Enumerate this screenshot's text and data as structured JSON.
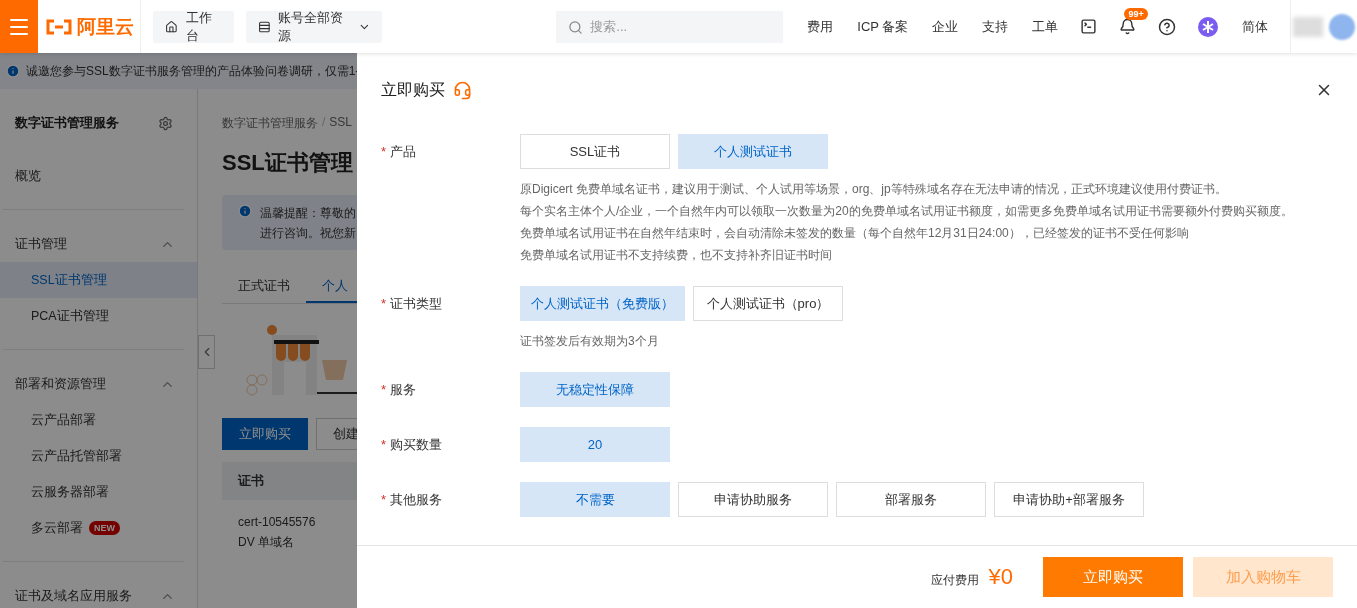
{
  "header": {
    "logo": "阿里云",
    "workbench": "工作台",
    "resources": "账号全部资源",
    "search": {
      "placeholder": "搜索..."
    },
    "nav": [
      "费用",
      "ICP 备案",
      "企业",
      "支持",
      "工单"
    ],
    "notification_badge": "99+",
    "language": "简体"
  },
  "banner": {
    "text": "诚邀您参与SSL数字证书服务管理的产品体验问卷调研，仅需1-"
  },
  "sidebar": {
    "title": "数字证书管理服务",
    "items": [
      {
        "label": "概览",
        "selected": false
      }
    ],
    "groups": [
      {
        "label": "证书管理",
        "expanded": true,
        "children": [
          {
            "label": "SSL证书管理",
            "selected": true
          },
          {
            "label": "PCA证书管理",
            "selected": false
          }
        ]
      },
      {
        "label": "部署和资源管理",
        "expanded": true,
        "children": [
          {
            "label": "云产品部署",
            "selected": false
          },
          {
            "label": "云产品托管部署",
            "selected": false
          },
          {
            "label": "云服务器部署",
            "selected": false
          },
          {
            "label": "多云部署",
            "selected": false,
            "badge": "NEW"
          }
        ]
      },
      {
        "label": "证书及域名应用服务",
        "expanded": true
      }
    ]
  },
  "main": {
    "breadcrumb": {
      "items": [
        "数字证书管理服务",
        "SSL"
      ],
      "separators": [
        "/"
      ]
    },
    "title": "SSL证书管理",
    "alert": [
      "温馨提醒：尊敬的",
      "进行咨询。祝您新"
    ],
    "tabs": [
      {
        "label": "正式证书",
        "selected": false
      },
      {
        "label": "个人",
        "selected": true
      }
    ],
    "buttons": [
      {
        "label": "立即购买",
        "kind": "primary"
      },
      {
        "label": "创建",
        "kind": "default"
      }
    ],
    "table": {
      "columns": [
        "证书"
      ],
      "rows": [
        [
          "cert-10545576",
          "DV 单域名"
        ]
      ]
    }
  },
  "drawer": {
    "title": "立即购买",
    "rows": [
      {
        "label": "产品",
        "required_mark": "*",
        "options": [
          {
            "label": "SSL证书",
            "selected": false
          },
          {
            "label": "个人测试证书",
            "selected": true
          }
        ],
        "notes": [
          "原Digicert 免费单域名证书，建议用于测试、个人试用等场景，org、jp等特殊域名存在无法申请的情况，正式环境建议使用付费证书。",
          "每个实名主体个人/企业，一个自然年内可以领取一次数量为20的免费单域名试用证书额度，如需更多免费单域名试用证书需要额外付费购买额度。",
          "免费单域名试用证书在自然年结束时，会自动清除未签发的数量（每个自然年12月31日24:00），已经签发的证书不受任何影响",
          "免费单域名试用证书不支持续费，也不支持补齐旧证书时间"
        ]
      },
      {
        "label": "证书类型",
        "required_mark": "*",
        "options": [
          {
            "label": "个人测试证书（免费版）",
            "selected": true
          },
          {
            "label": "个人测试证书（pro）",
            "selected": false
          }
        ],
        "notes": [
          "证书签发后有效期为3个月"
        ]
      },
      {
        "label": "服务",
        "required_mark": "*",
        "options": [
          {
            "label": "无稳定性保障",
            "selected": true
          }
        ]
      },
      {
        "label": "购买数量",
        "required_mark": "*",
        "options": [
          {
            "label": "20",
            "selected": true
          }
        ]
      },
      {
        "label": "其他服务",
        "required_mark": "*",
        "options": [
          {
            "label": "不需要",
            "selected": true
          },
          {
            "label": "申请协助服务",
            "selected": false
          },
          {
            "label": "部署服务",
            "selected": false
          },
          {
            "label": "申请协助+部署服务",
            "selected": false
          }
        ]
      }
    ],
    "footer": {
      "fee_label": "应付费用",
      "fee": "¥0",
      "buttons": [
        {
          "label": "立即购买",
          "disabled": false
        },
        {
          "label": "加入购物车",
          "disabled": true
        }
      ]
    }
  }
}
